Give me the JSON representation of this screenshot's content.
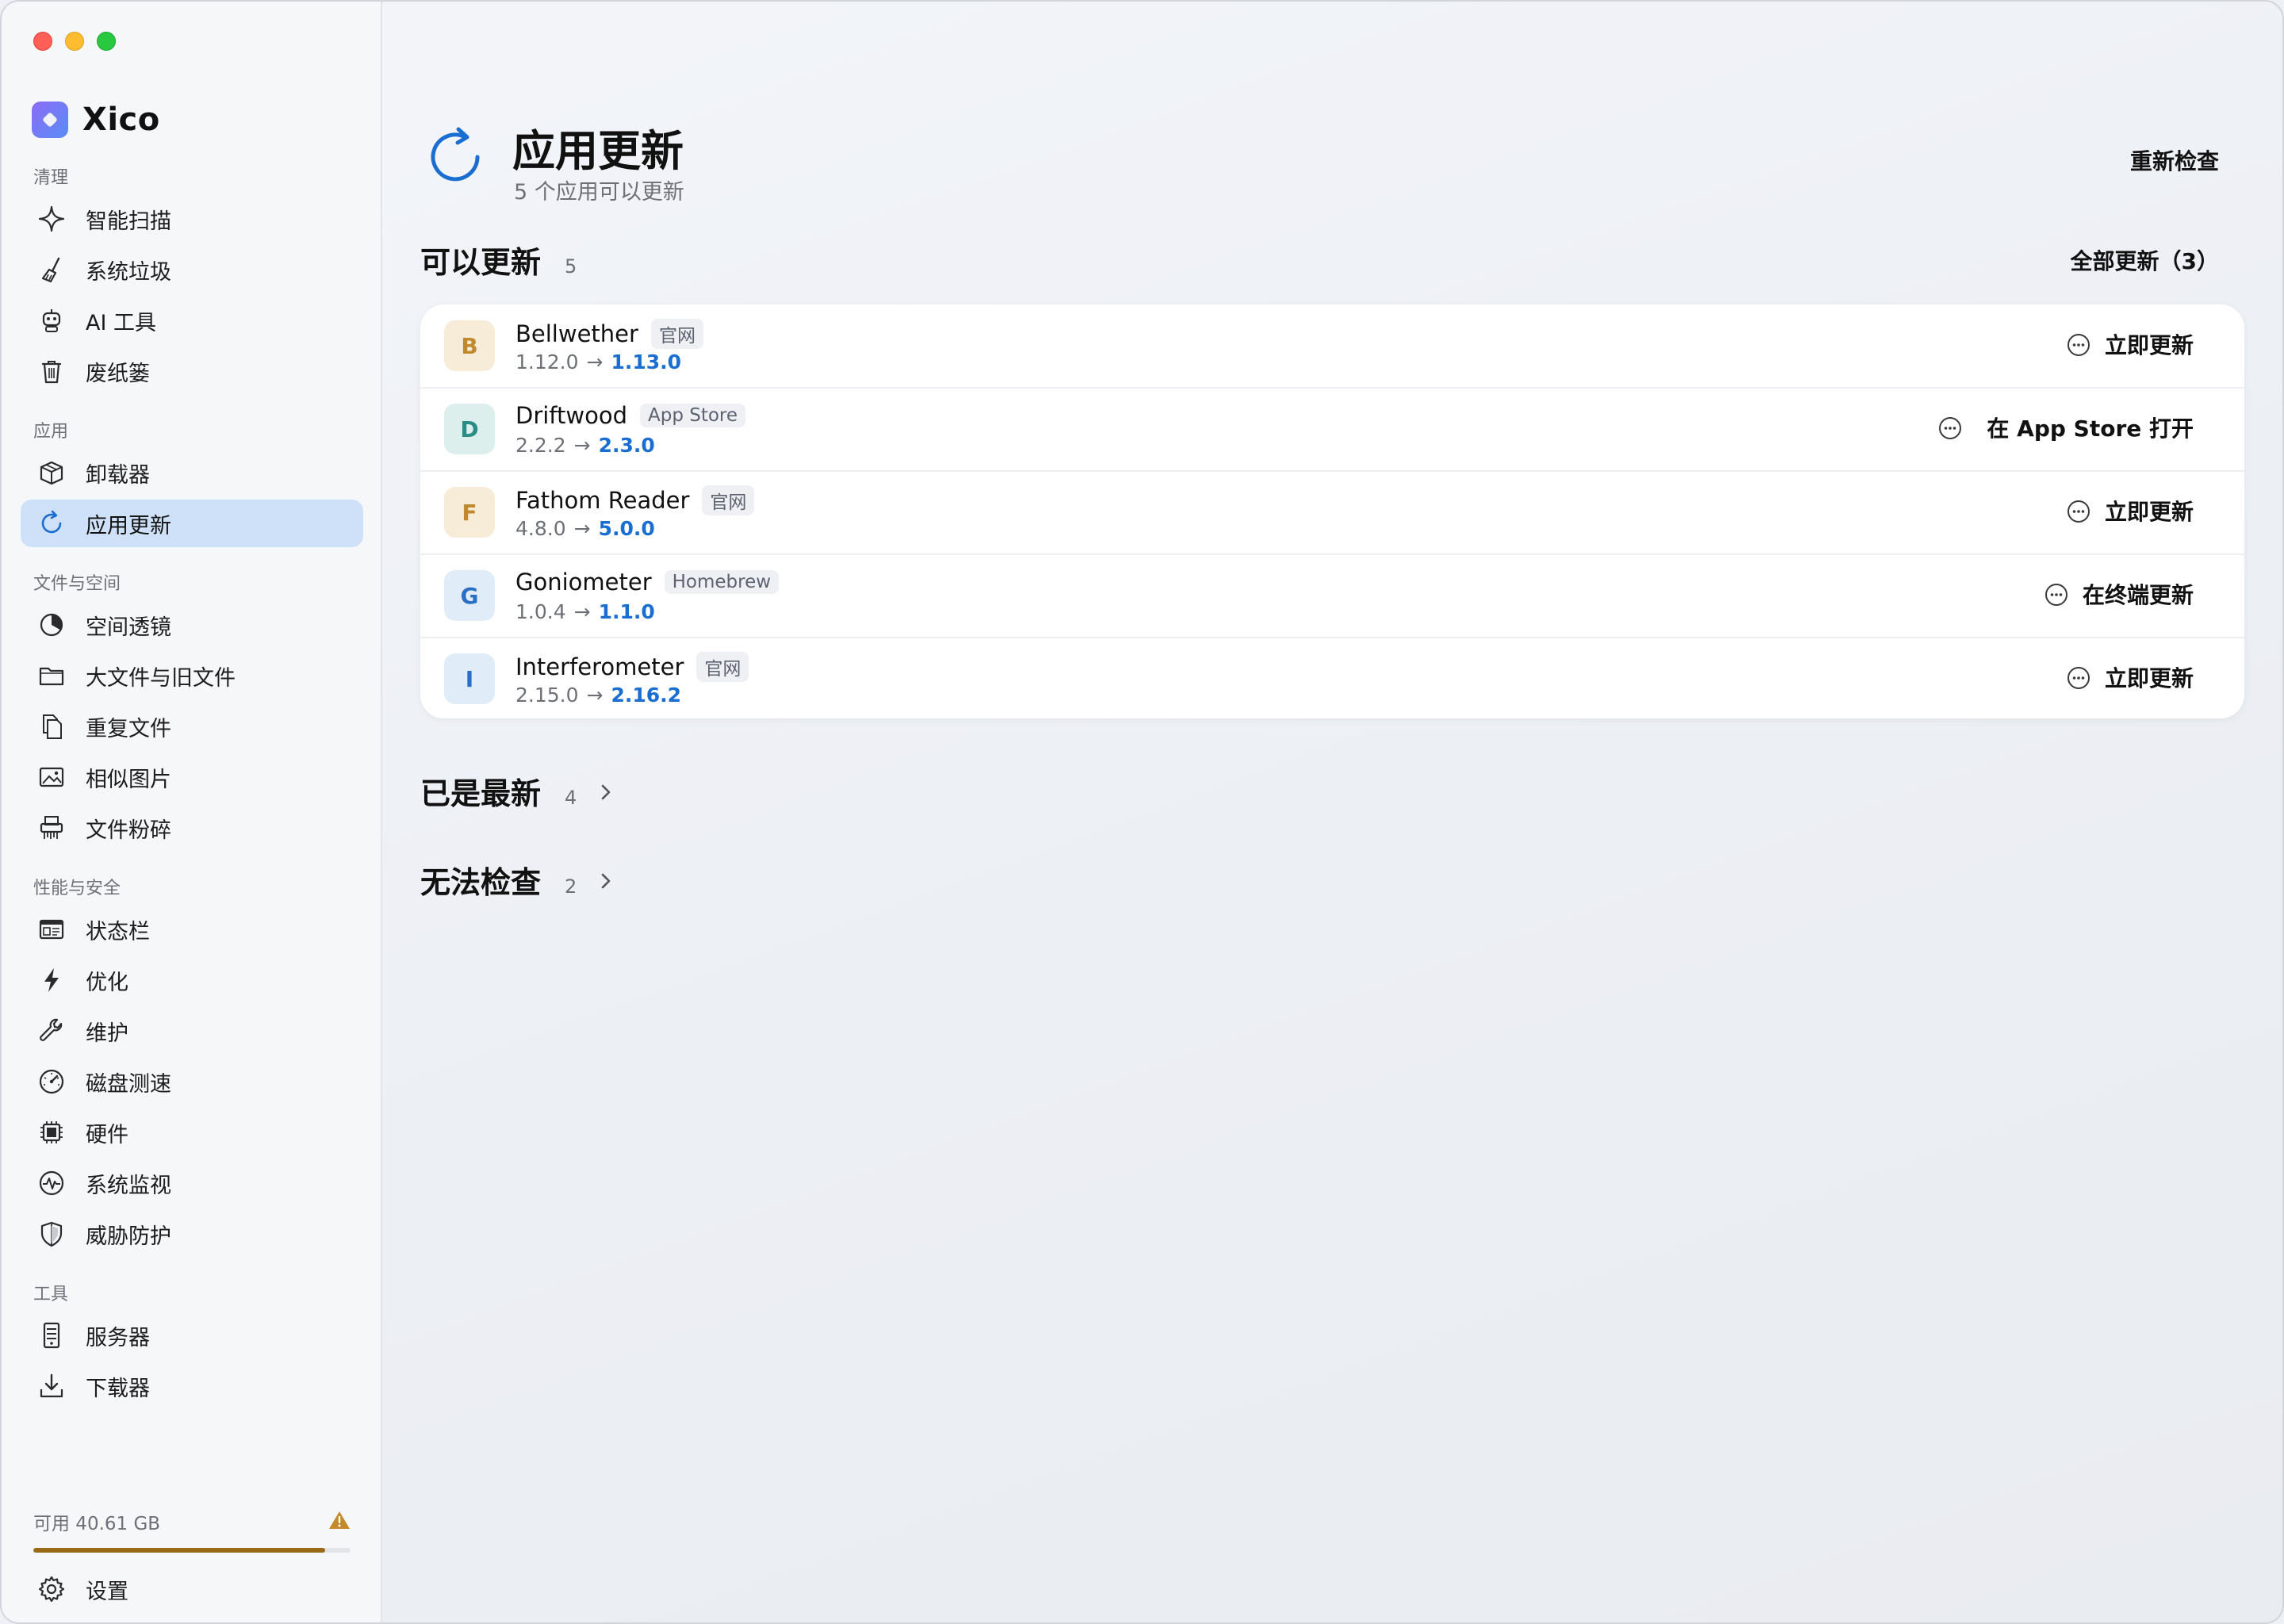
{
  "brand": {
    "name": "Xico"
  },
  "sidebar": {
    "sections": [
      {
        "title": "清理"
      },
      {
        "title": "应用"
      },
      {
        "title": "文件与空间"
      },
      {
        "title": "性能与安全"
      },
      {
        "title": "工具"
      }
    ],
    "items": [
      {
        "label": "智能扫描",
        "icon": "sparkle-icon"
      },
      {
        "label": "系统垃圾",
        "icon": "broom-icon"
      },
      {
        "label": "AI 工具",
        "icon": "robot-icon"
      },
      {
        "label": "废纸篓",
        "icon": "trash-icon"
      },
      {
        "label": "卸载器",
        "icon": "box-icon"
      },
      {
        "label": "应用更新",
        "icon": "refresh-icon",
        "active": true
      },
      {
        "label": "空间透镜",
        "icon": "pie-chart-icon"
      },
      {
        "label": "大文件与旧文件",
        "icon": "folder-icon"
      },
      {
        "label": "重复文件",
        "icon": "duplicate-icon"
      },
      {
        "label": "相似图片",
        "icon": "photo-icon"
      },
      {
        "label": "文件粉碎",
        "icon": "shredder-icon"
      },
      {
        "label": "状态栏",
        "icon": "menubar-icon"
      },
      {
        "label": "优化",
        "icon": "bolt-icon"
      },
      {
        "label": "维护",
        "icon": "wrench-icon"
      },
      {
        "label": "磁盘测速",
        "icon": "gauge-icon"
      },
      {
        "label": "硬件",
        "icon": "chip-icon"
      },
      {
        "label": "系统监视",
        "icon": "pulse-icon"
      },
      {
        "label": "威胁防护",
        "icon": "shield-icon"
      },
      {
        "label": "服务器",
        "icon": "server-icon"
      },
      {
        "label": "下载器",
        "icon": "download-icon"
      }
    ],
    "storage": {
      "label": "可用 40.61 GB",
      "used_fraction": 0.92,
      "warning_icon": "warning-icon"
    },
    "settings": {
      "label": "设置",
      "icon": "gear-icon"
    }
  },
  "main": {
    "title": "应用更新",
    "subtitle": "5 个应用可以更新",
    "recheck_label": "重新检查",
    "available": {
      "title": "可以更新",
      "count": "5",
      "update_all_label": "全部更新（3）",
      "apps": [
        {
          "letter": "B",
          "name": "Bellwether",
          "source": "官网",
          "old": "1.12.0",
          "new": "1.13.0",
          "action": "立即更新",
          "icon_bg": "#f6ecd8",
          "icon_fg": "#c08a2c"
        },
        {
          "letter": "D",
          "name": "Driftwood",
          "source": "App Store",
          "old": "2.2.2",
          "new": "2.3.0",
          "action": "在 App Store 打开",
          "icon_bg": "#dcefed",
          "icon_fg": "#2a8c86"
        },
        {
          "letter": "F",
          "name": "Fathom Reader",
          "source": "官网",
          "old": "4.8.0",
          "new": "5.0.0",
          "action": "立即更新",
          "icon_bg": "#f6ecd8",
          "icon_fg": "#c08a2c"
        },
        {
          "letter": "G",
          "name": "Goniometer",
          "source": "Homebrew",
          "old": "1.0.4",
          "new": "1.1.0",
          "action": "在终端更新",
          "icon_bg": "#e1ecf9",
          "icon_fg": "#2a6fc4"
        },
        {
          "letter": "I",
          "name": "Interferometer",
          "source": "官网",
          "old": "2.15.0",
          "new": "2.16.2",
          "action": "立即更新",
          "icon_bg": "#e1ecf9",
          "icon_fg": "#2a6fc4"
        }
      ]
    },
    "up_to_date": {
      "title": "已是最新",
      "count": "4"
    },
    "cannot_check": {
      "title": "无法检查",
      "count": "2"
    }
  },
  "colors": {
    "accent": "#1b6ed1",
    "active_bg": "#cfe1f8",
    "storage_fill": "#9a6b16"
  }
}
